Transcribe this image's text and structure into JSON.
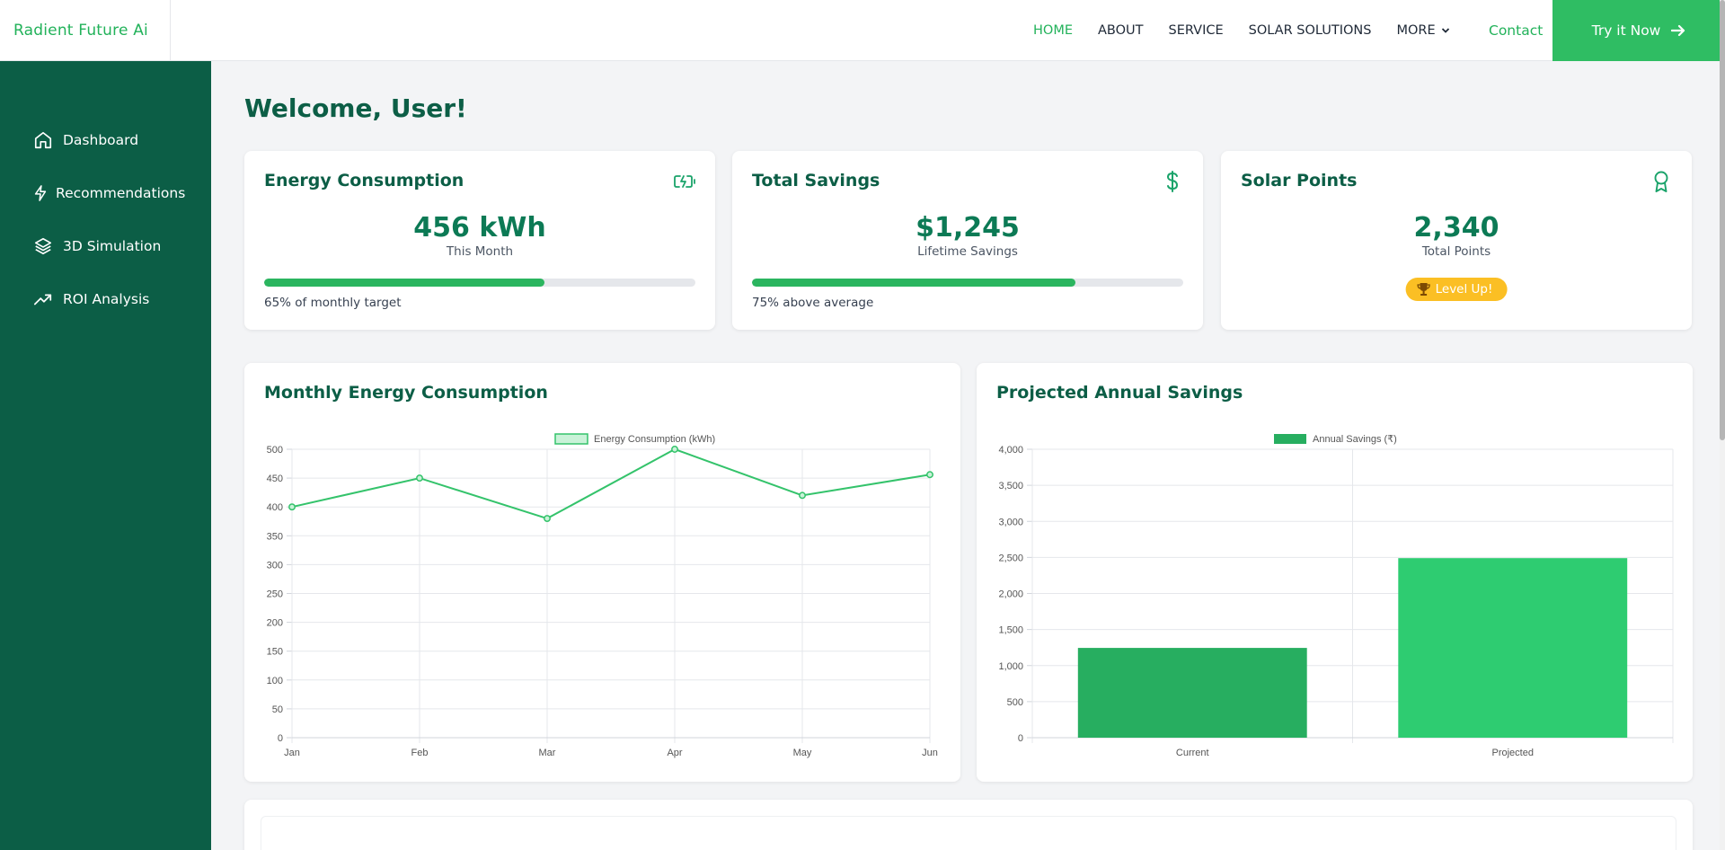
{
  "brand": "Radient Future Ai",
  "nav": {
    "items": [
      "HOME",
      "ABOUT",
      "SERVICE",
      "SOLAR SOLUTIONS",
      "MORE"
    ],
    "contact": "Contact",
    "cta": "Try it Now"
  },
  "sidebar": {
    "items": [
      {
        "label": "Dashboard",
        "icon": "home-icon"
      },
      {
        "label": "Recommendations",
        "icon": "lightning-icon"
      },
      {
        "label": "3D Simulation",
        "icon": "layers-icon"
      },
      {
        "label": "ROI Analysis",
        "icon": "trending-up-icon"
      }
    ]
  },
  "welcome": "Welcome, User!",
  "cards": {
    "energy": {
      "title": "Energy Consumption",
      "value": "456 kWh",
      "sub": "This Month",
      "progress": 65,
      "progress_label": "65% of monthly target",
      "icon": "battery-charging-icon"
    },
    "savings": {
      "title": "Total Savings",
      "value": "$1,245",
      "sub": "Lifetime Savings",
      "progress": 75,
      "progress_label": "75% above average",
      "icon": "dollar-icon"
    },
    "points": {
      "title": "Solar Points",
      "value": "2,340",
      "sub": "Total Points",
      "badge": "Level Up!",
      "icon": "award-icon"
    }
  },
  "colors": {
    "primary": "#0c5e46",
    "accent": "#2fbd63",
    "badge": "#fbbf24"
  },
  "chart_data": [
    {
      "type": "line",
      "title": "Monthly Energy Consumption",
      "categories": [
        "Jan",
        "Feb",
        "Mar",
        "Apr",
        "May",
        "Jun"
      ],
      "series": [
        {
          "name": "Energy Consumption (kWh)",
          "values": [
            400,
            450,
            380,
            500,
            420,
            456
          ]
        }
      ],
      "ylim": [
        0,
        500
      ],
      "yticks": [
        0,
        50,
        100,
        150,
        200,
        250,
        300,
        350,
        400,
        450,
        500
      ],
      "legend": "top-center",
      "grid": true
    },
    {
      "type": "bar",
      "title": "Projected Annual Savings",
      "categories": [
        "Current",
        "Projected"
      ],
      "series": [
        {
          "name": "Annual Savings (₹)",
          "values": [
            1245,
            2490
          ]
        }
      ],
      "ylim": [
        0,
        4000
      ],
      "yticks": [
        "0",
        "500",
        "1,000",
        "1,500",
        "2,000",
        "2,500",
        "3,000",
        "3,500",
        "4,000"
      ],
      "legend": "top-center",
      "grid": true
    }
  ]
}
